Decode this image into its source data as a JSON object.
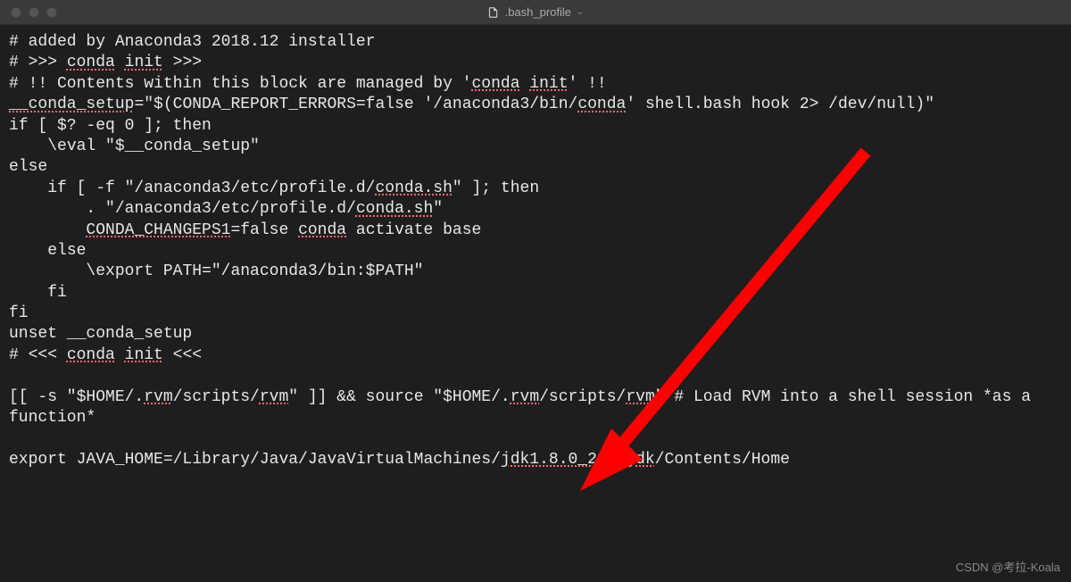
{
  "titlebar": {
    "filename": ".bash_profile"
  },
  "content": {
    "lines": [
      {
        "segs": [
          {
            "t": "# added by Anaconda3 2018.12 installer"
          }
        ]
      },
      {
        "segs": [
          {
            "t": "# >>> "
          },
          {
            "t": "conda",
            "u": true
          },
          {
            "t": " "
          },
          {
            "t": "init",
            "u": true
          },
          {
            "t": " >>>"
          }
        ]
      },
      {
        "segs": [
          {
            "t": "# !! Contents within this block are managed by '"
          },
          {
            "t": "conda",
            "u": true
          },
          {
            "t": " "
          },
          {
            "t": "init",
            "u": true
          },
          {
            "t": "' !!"
          }
        ]
      },
      {
        "segs": [
          {
            "t": "__conda_setup",
            "u": true
          },
          {
            "t": "=\"$(CONDA_REPORT_ERRORS=false '/anaconda3/bin/"
          },
          {
            "t": "conda",
            "u": true
          },
          {
            "t": "' shell.bash hook 2> /dev/null)\""
          }
        ]
      },
      {
        "segs": [
          {
            "t": "if [ $? -eq 0 ]; then"
          }
        ]
      },
      {
        "segs": [
          {
            "t": "    \\eval \"$__conda_setup\""
          }
        ]
      },
      {
        "segs": [
          {
            "t": "else"
          }
        ]
      },
      {
        "segs": [
          {
            "t": "    if [ -f \"/anaconda3/etc/profile.d/"
          },
          {
            "t": "conda.sh",
            "u": true
          },
          {
            "t": "\" ]; then"
          }
        ]
      },
      {
        "segs": [
          {
            "t": "        . \"/anaconda3/etc/profile.d/"
          },
          {
            "t": "conda.sh",
            "u": true
          },
          {
            "t": "\""
          }
        ]
      },
      {
        "segs": [
          {
            "t": "        "
          },
          {
            "t": "CONDA_CHANGEPS1",
            "u": true
          },
          {
            "t": "=false "
          },
          {
            "t": "conda",
            "u": true
          },
          {
            "t": " activate base"
          }
        ]
      },
      {
        "segs": [
          {
            "t": "    else"
          }
        ]
      },
      {
        "segs": [
          {
            "t": "        \\export PATH=\"/anaconda3/bin:$PATH\""
          }
        ]
      },
      {
        "segs": [
          {
            "t": "    fi"
          }
        ]
      },
      {
        "segs": [
          {
            "t": "fi"
          }
        ]
      },
      {
        "segs": [
          {
            "t": "unset __conda_setup"
          }
        ]
      },
      {
        "segs": [
          {
            "t": "# <<< "
          },
          {
            "t": "conda",
            "u": true
          },
          {
            "t": " "
          },
          {
            "t": "init",
            "u": true
          },
          {
            "t": " <<<"
          }
        ]
      },
      {
        "segs": [
          {
            "t": ""
          }
        ]
      },
      {
        "segs": [
          {
            "t": "[[ -s \"$HOME/."
          },
          {
            "t": "rvm",
            "u": true
          },
          {
            "t": "/scripts/"
          },
          {
            "t": "rvm",
            "u": true
          },
          {
            "t": "\" ]] && source \"$HOME/."
          },
          {
            "t": "rvm",
            "u": true
          },
          {
            "t": "/scripts/"
          },
          {
            "t": "rvm",
            "u": true
          },
          {
            "t": "\" # Load RVM into a shell session *as a function*"
          }
        ]
      },
      {
        "segs": [
          {
            "t": ""
          }
        ]
      },
      {
        "segs": [
          {
            "t": "export JAVA_HOME=/Library/Java/JavaVirtualMachines/"
          },
          {
            "t": "jdk1.8.0_211.jdk",
            "u": true
          },
          {
            "t": "/Contents/Home"
          }
        ]
      }
    ]
  },
  "watermark": "CSDN @考拉-Koala"
}
